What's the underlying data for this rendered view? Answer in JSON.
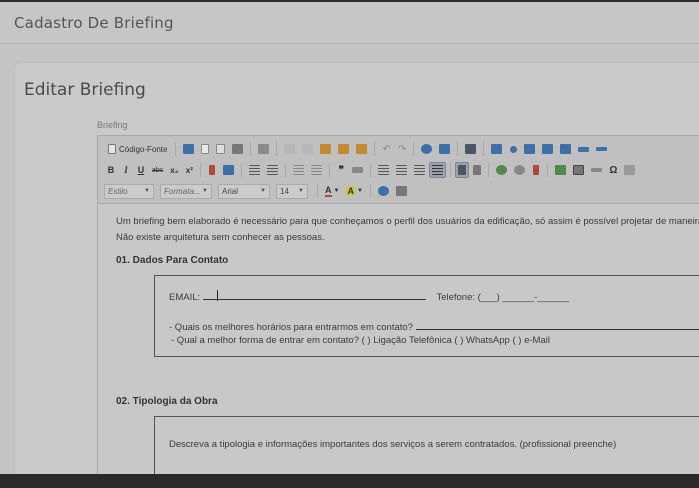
{
  "header": {
    "title": "Cadastro De Briefing"
  },
  "card": {
    "title": "Editar Briefing"
  },
  "field": {
    "label": "Briefing"
  },
  "toolbar": {
    "source_label": "Código-Fonte",
    "bold": "B",
    "italic": "I",
    "underline": "U",
    "strike": "abc",
    "subscript": "x₂",
    "superscript": "x²",
    "style_placeholder": "Estilo",
    "format_placeholder": "Formata...",
    "font_value": "Arial",
    "size_value": "14",
    "text_color_label": "A",
    "bg_color_label": "A",
    "omega": "Ω",
    "blockquote": "❞",
    "colors": {
      "blue": "#3d6fa8",
      "red": "#b04a3a",
      "orange": "#c68a2e",
      "green": "#4f8a4a",
      "yellow_bg": "#c8c84a"
    }
  },
  "content": {
    "intro_line1": "Um briefing bem elaborado é necessário para que conheçamos o perfil dos usuários da edificação, só assim é possível projetar de maneira e",
    "intro_line2": "Não existe arquitetura sem conhecer as pessoas.",
    "section1_title": "01. Dados Para Contato",
    "email_label": "EMAIL:",
    "telefone_label": "Telefone: (___) ______-______",
    "horarios_label": "- Quais os melhores horários para entrarmos em contato?",
    "forma_label": "- Qual a melhor forma de entrar em contato? (   )  Ligação Telefônica    (   )  WhatsApp    (   )  e-Mail",
    "section2_title": "02. Tipologia da Obra",
    "tipologia_text": "Descreva a tipologia e informações importantes dos serviços a serem contratados. (profissional preenche)"
  }
}
